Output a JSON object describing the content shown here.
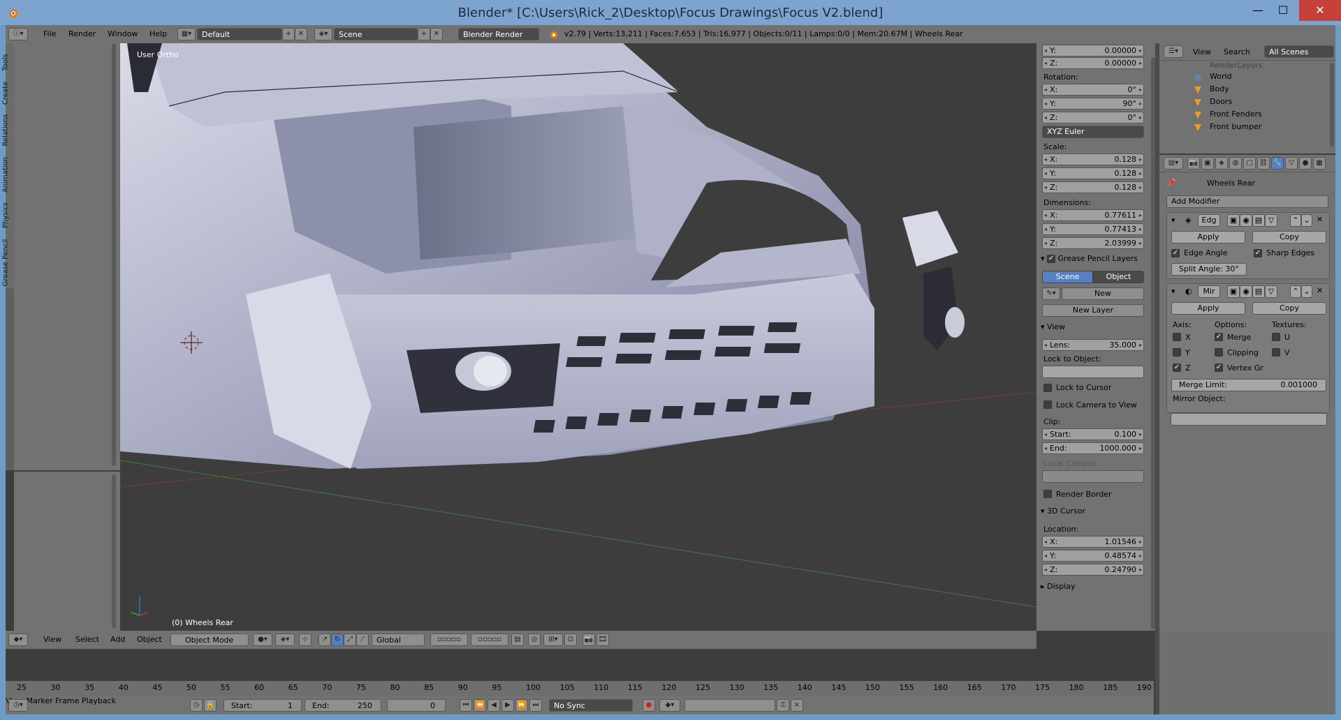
{
  "window": {
    "title": "Blender* [C:\\Users\\Rick_2\\Desktop\\Focus Drawings\\Focus V2.blend]",
    "minimize": "—",
    "maximize": "☐",
    "close": "✕"
  },
  "info_header": {
    "menus": [
      "File",
      "Render",
      "Window",
      "Help"
    ],
    "layout": "Default",
    "scene": "Scene",
    "engine": "Blender Render",
    "stats": "v2.79 | Verts:13,211 | Faces:7,653 | Tris:16,977 | Objects:0/11 | Lamps:0/0 | Mem:20.67M | Wheels Rear"
  },
  "tool_tabs": [
    "Tools",
    "Create",
    "Relations",
    "Animation",
    "Physics",
    "Grease Pencil"
  ],
  "viewport": {
    "view_label": "User Ortho",
    "object_label": "(0) Wheels Rear"
  },
  "n_panel": {
    "location_partial": [
      {
        "k": "Y:",
        "v": "0.00000"
      },
      {
        "k": "Z:",
        "v": "0.00000"
      }
    ],
    "rotation_label": "Rotation:",
    "rotation": [
      {
        "k": "X:",
        "v": "0°"
      },
      {
        "k": "Y:",
        "v": "90°"
      },
      {
        "k": "Z:",
        "v": "0°"
      }
    ],
    "rotation_mode": "XYZ Euler",
    "scale_label": "Scale:",
    "scale": [
      {
        "k": "X:",
        "v": "0.128"
      },
      {
        "k": "Y:",
        "v": "0.128"
      },
      {
        "k": "Z:",
        "v": "0.128"
      }
    ],
    "dimensions_label": "Dimensions:",
    "dimensions": [
      {
        "k": "X:",
        "v": "0.77611"
      },
      {
        "k": "Y:",
        "v": "0.77413"
      },
      {
        "k": "Z:",
        "v": "2.03999"
      }
    ],
    "grease_pencil_title": "Grease Pencil Layers",
    "gp_scene": "Scene",
    "gp_object": "Object",
    "gp_new": "New",
    "gp_new_layer": "New Layer",
    "view_title": "View",
    "lens_label": "Lens:",
    "lens_value": "35.000",
    "lock_to_object": "Lock to Object:",
    "lock_to_cursor": "Lock to Cursor",
    "lock_camera": "Lock Camera to View",
    "clip_label": "Clip:",
    "clip_start_label": "Start:",
    "clip_start": "0.100",
    "clip_end_label": "End:",
    "clip_end": "1000.000",
    "local_camera": "Local Camera:",
    "render_border": "Render Border",
    "cursor_title": "3D Cursor",
    "cursor_location": "Location:",
    "cursor": [
      {
        "k": "X:",
        "v": "1.01546"
      },
      {
        "k": "Y:",
        "v": "0.48574"
      },
      {
        "k": "Z:",
        "v": "0.24790"
      }
    ],
    "display_title": "Display"
  },
  "outliner": {
    "view": "View",
    "search": "Search",
    "filter": "All Scenes",
    "partial_row": "RenderLayers",
    "items": [
      "World",
      "Body",
      "Doors",
      "Front Fenders",
      "Front bumper"
    ]
  },
  "properties": {
    "object_name": "Wheels Rear",
    "add_modifier": "Add Modifier",
    "mod1": {
      "name": "Edg",
      "apply": "Apply",
      "copy": "Copy",
      "edge_angle": "Edge Angle",
      "sharp_edges": "Sharp Edges",
      "split_angle": "Split Angle: 30°"
    },
    "mod2": {
      "name": "Mir",
      "apply": "Apply",
      "copy": "Copy",
      "axis": "Axis:",
      "options": "Options:",
      "textures": "Textures:",
      "x": "X",
      "y": "Y",
      "z": "Z",
      "merge": "Merge",
      "clipping": "Clipping",
      "vertex_gr": "Vertex Gr",
      "u": "U",
      "v": "V",
      "merge_limit_label": "Merge Limit:",
      "merge_limit": "0.001000",
      "mirror_object": "Mirror Object:"
    }
  },
  "view3d_header": {
    "menus": [
      "View",
      "Select",
      "Add",
      "Object"
    ],
    "mode": "Object Mode",
    "orientation": "Global"
  },
  "timeline": {
    "ticks": [
      "25",
      "30",
      "35",
      "40",
      "45",
      "50",
      "55",
      "60",
      "65",
      "70",
      "75",
      "80",
      "85",
      "90",
      "95",
      "100",
      "105",
      "110",
      "115",
      "120",
      "125",
      "130",
      "135",
      "140",
      "145",
      "150",
      "155",
      "160",
      "165",
      "170",
      "175",
      "180",
      "185",
      "190"
    ],
    "menus": [
      "View",
      "Marker",
      "Frame",
      "Playback"
    ],
    "start_label": "Start:",
    "start": "1",
    "end_label": "End:",
    "end": "250",
    "current": "0",
    "sync": "No Sync"
  }
}
